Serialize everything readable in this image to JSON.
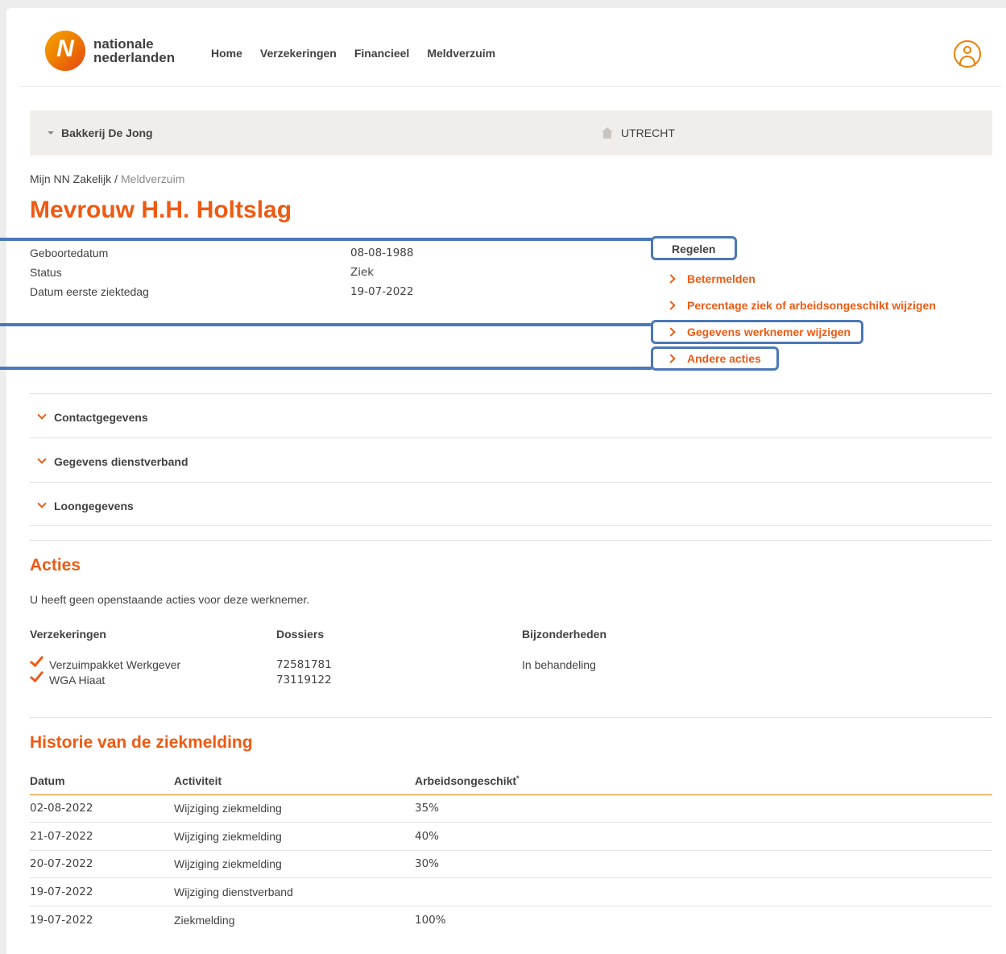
{
  "header": {
    "logo_line1": "nationale",
    "logo_line2": "nederlanden",
    "nav": [
      "Home",
      "Verzekeringen",
      "Financieel",
      "Meldverzuim"
    ]
  },
  "employer": {
    "name": "Bakkerij De Jong",
    "city": "UTRECHT"
  },
  "breadcrumb": {
    "root": "Mijn NN Zakelijk",
    "separator": "/",
    "current": "Meldverzuim"
  },
  "title": "Mevrouw H.H. Holtslag",
  "details": [
    {
      "label": "Geboortedatum",
      "value": "08-08-1988"
    },
    {
      "label": "Status",
      "value": "Ziek"
    },
    {
      "label": "Datum eerste ziektedag",
      "value": "19-07-2022"
    }
  ],
  "regelen": {
    "title": "Regelen",
    "actions": [
      "Betermelden",
      "Percentage ziek of arbeidsongeschikt wijzigen",
      "Gegevens werknemer wijzigen",
      "Andere acties"
    ]
  },
  "accordions": [
    "Contactgegevens",
    "Gegevens dienstverband",
    "Loongegevens"
  ],
  "acties": {
    "title": "Acties",
    "intro": "U heeft geen openstaande acties voor deze werknemer.",
    "headers": [
      "Verzekeringen",
      "Dossiers",
      "Bijzonderheden"
    ],
    "insurances": [
      "Verzuimpakket Werkgever",
      "WGA Hiaat"
    ],
    "dossiers": [
      "72581781",
      "73119122"
    ],
    "bijzonderheden": [
      "In behandeling"
    ]
  },
  "historie": {
    "title": "Historie van de ziekmelding",
    "headers": [
      "Datum",
      "Activiteit",
      "Arbeidsongeschikt"
    ],
    "header_sup": "*",
    "rows": [
      [
        "02-08-2022",
        "Wijziging ziekmelding",
        "35%"
      ],
      [
        "21-07-2022",
        "Wijziging ziekmelding",
        "40%"
      ],
      [
        "20-07-2022",
        "Wijziging ziekmelding",
        "30%"
      ],
      [
        "19-07-2022",
        "Wijziging dienstverband",
        ""
      ],
      [
        "19-07-2022",
        "Ziekmelding",
        "100%"
      ]
    ]
  },
  "colors": {
    "accent": "#ee5a12",
    "highlight_outline": "#4a78b9",
    "employer_bar": "#f1edea"
  }
}
